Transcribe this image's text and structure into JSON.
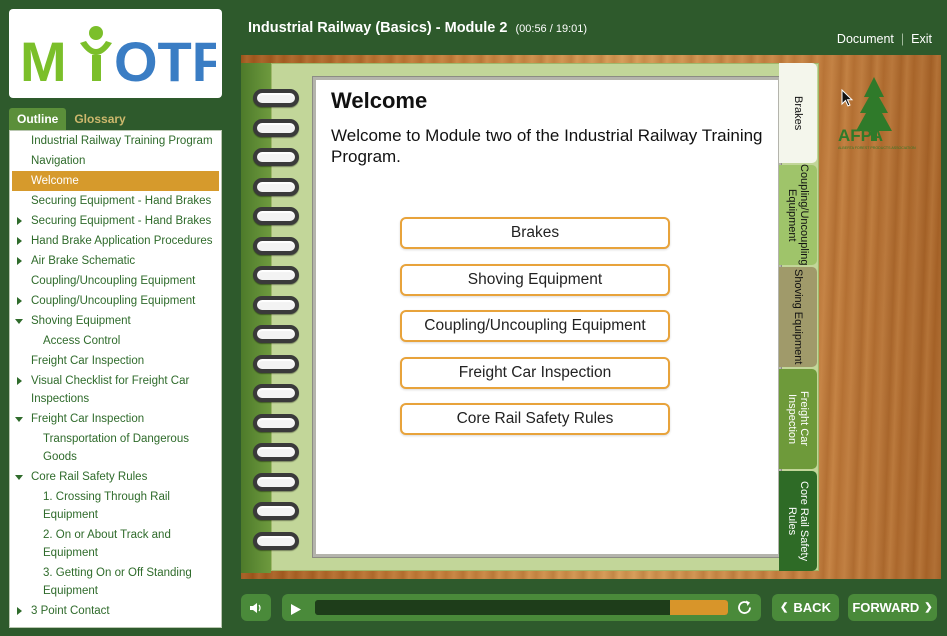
{
  "logo": {
    "text": "MYOTF"
  },
  "sidebar": {
    "tabs": [
      "Outline",
      "Glossary"
    ],
    "items": [
      {
        "label": "Industrial Railway Training Program",
        "level": 1,
        "arrow": "none",
        "selected": false
      },
      {
        "label": "Navigation",
        "level": 1,
        "arrow": "none",
        "selected": false
      },
      {
        "label": "Welcome",
        "level": 1,
        "arrow": "none",
        "selected": true
      },
      {
        "label": "Securing Equipment - Hand Brakes",
        "level": 1,
        "arrow": "none",
        "selected": false
      },
      {
        "label": "Securing Equipment - Hand Brakes",
        "level": 1,
        "arrow": "right",
        "selected": false
      },
      {
        "label": "Hand Brake Application Procedures",
        "level": 1,
        "arrow": "right",
        "selected": false
      },
      {
        "label": "Air Brake Schematic",
        "level": 1,
        "arrow": "right",
        "selected": false
      },
      {
        "label": "Coupling/Uncoupling Equipment",
        "level": 1,
        "arrow": "none",
        "selected": false
      },
      {
        "label": "Coupling/Uncoupling Equipment",
        "level": 1,
        "arrow": "right",
        "selected": false
      },
      {
        "label": "Shoving Equipment",
        "level": 1,
        "arrow": "down",
        "selected": false
      },
      {
        "label": "Access Control",
        "level": 2,
        "arrow": "none",
        "selected": false
      },
      {
        "label": "Freight Car Inspection",
        "level": 1,
        "arrow": "none",
        "selected": false
      },
      {
        "label": "Visual Checklist for Freight Car Inspections",
        "level": 1,
        "arrow": "right",
        "selected": false
      },
      {
        "label": "Freight Car Inspection",
        "level": 1,
        "arrow": "down",
        "selected": false
      },
      {
        "label": "Transportation of Dangerous Goods",
        "level": 2,
        "arrow": "none",
        "selected": false
      },
      {
        "label": "Core Rail Safety Rules",
        "level": 1,
        "arrow": "down",
        "selected": false
      },
      {
        "label": "1. Crossing Through Rail Equipment",
        "level": 2,
        "arrow": "none",
        "selected": false
      },
      {
        "label": "2. On or About Track and Equipment",
        "level": 2,
        "arrow": "none",
        "selected": false
      },
      {
        "label": "3. Getting On or Off Standing Equipment",
        "level": 2,
        "arrow": "none",
        "selected": false
      },
      {
        "label": "3 Point Contact",
        "level": 1,
        "arrow": "right",
        "selected": false
      }
    ]
  },
  "header": {
    "title": "Industrial Railway (Basics) - Module 2",
    "time": "(00:56 / 19:01)",
    "links": [
      "Document",
      "Exit"
    ]
  },
  "page": {
    "heading": "Welcome",
    "intro": "Welcome to Module two of the Industrial Railway Training Program.",
    "buttons": [
      "Brakes",
      "Shoving Equipment",
      "Coupling/Uncoupling Equipment",
      "Freight Car Inspection",
      "Core Rail Safety Rules"
    ]
  },
  "side_tabs": [
    {
      "label": "Brakes",
      "color": "#f4f6ec"
    },
    {
      "label": "Coupling/Uncoupling Equipment",
      "color": "#9fc46a"
    },
    {
      "label": "Shoving Equipment",
      "color": "#a09a6a"
    },
    {
      "label": "Freight Car Inspection",
      "color": "#6e9a3a"
    },
    {
      "label": "Core Rail Safety Rules",
      "color": "#2e6b26"
    }
  ],
  "brand": {
    "afpa": "AFPA",
    "afpa_sub": "ALBERTA FOREST PRODUCTS ASSOCIATION"
  },
  "player": {
    "back_label": "BACK",
    "forward_label": "FORWARD",
    "progress": 0.86
  },
  "colors": {
    "accent": "#d69a2c",
    "primary_green": "#4a8a3a",
    "background": "#2e5a2c"
  }
}
